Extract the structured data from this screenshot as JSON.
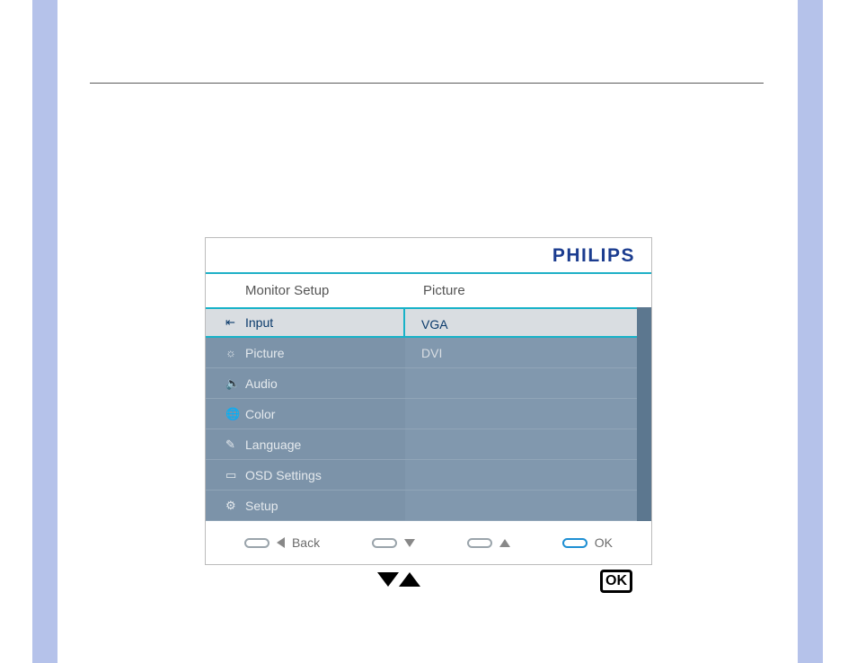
{
  "brand": "PHILIPS",
  "titles": {
    "left": "Monitor Setup",
    "right": "Picture"
  },
  "menu": {
    "items": [
      {
        "label": "Input",
        "selected": true
      },
      {
        "label": "Picture",
        "selected": false
      },
      {
        "label": "Audio",
        "selected": false
      },
      {
        "label": "Color",
        "selected": false
      },
      {
        "label": "Language",
        "selected": false
      },
      {
        "label": "OSD Settings",
        "selected": false
      },
      {
        "label": "Setup",
        "selected": false
      }
    ]
  },
  "submenu": {
    "items": [
      {
        "label": "VGA",
        "selected": true
      },
      {
        "label": "DVI",
        "selected": false
      }
    ]
  },
  "footer": {
    "back": "Back",
    "ok": "OK"
  },
  "icons": {
    "input": "input-icon",
    "picture": "sun-icon",
    "audio": "speaker-icon",
    "color": "globe-icon",
    "language": "language-icon",
    "osd": "screen-icon",
    "setup": "gear-icon"
  }
}
